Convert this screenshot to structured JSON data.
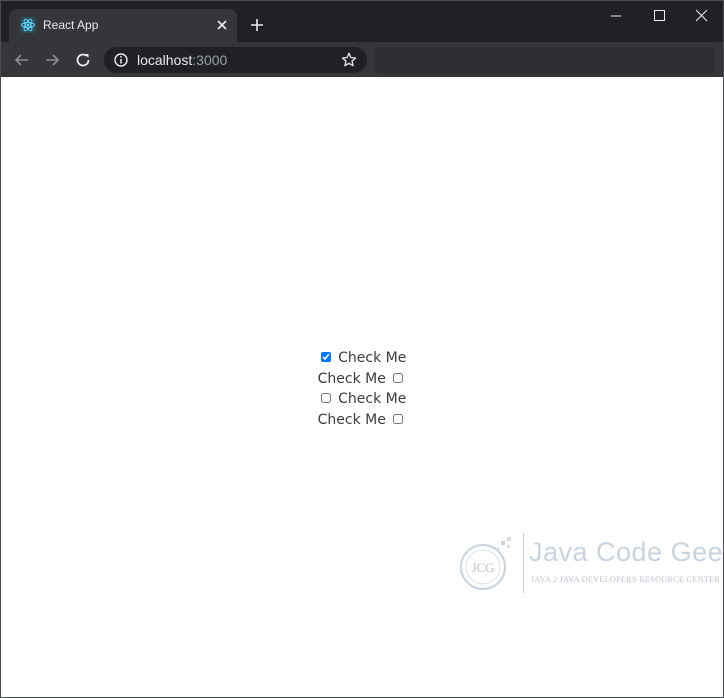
{
  "browser": {
    "tab": {
      "title": "React App",
      "favicon": "react-icon"
    },
    "url": {
      "host": "localhost",
      "port": ":3000"
    },
    "icons": [
      "back-arrow-icon",
      "forward-arrow-icon",
      "reload-icon",
      "info-icon",
      "star-icon",
      "close-icon",
      "plus-icon",
      "minimize-icon",
      "maximize-icon"
    ]
  },
  "page": {
    "checkboxes": [
      {
        "label": "Check Me",
        "checked": true,
        "label_side": "right"
      },
      {
        "label": "Check Me",
        "checked": false,
        "label_side": "left"
      },
      {
        "label": "Check Me",
        "checked": false,
        "label_side": "right"
      },
      {
        "label": "Check Me",
        "checked": false,
        "label_side": "left"
      }
    ]
  },
  "watermark": {
    "logo_text": "JCG",
    "title": "Java Code Geeks",
    "subtitle": "Java 2 Java Developers Resource Center"
  },
  "colors": {
    "titlebar": "#202124",
    "toolbar": "#35363a",
    "react": "#61dafb"
  }
}
